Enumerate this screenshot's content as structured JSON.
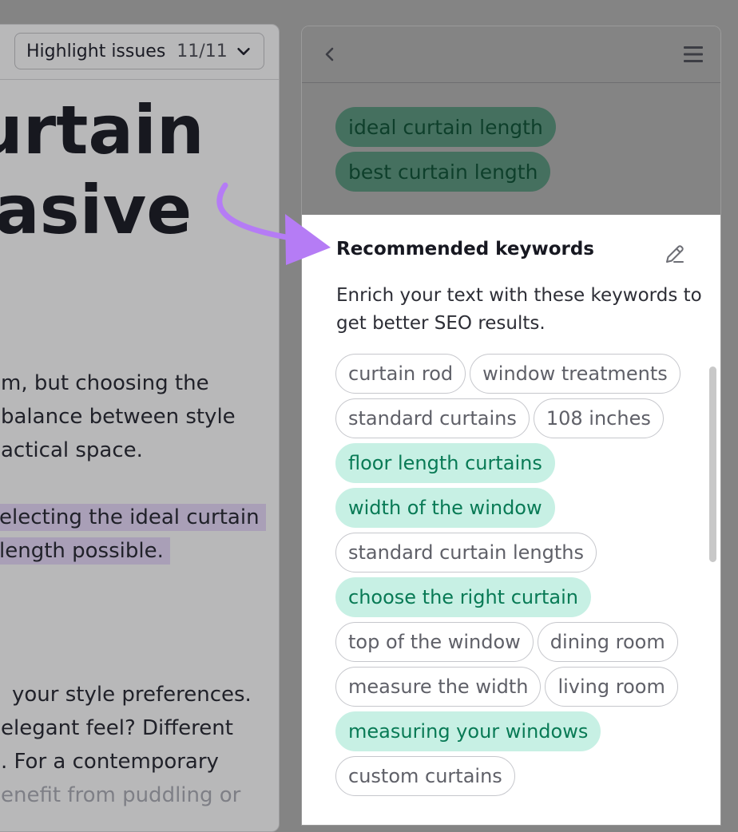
{
  "editor": {
    "highlight_label": "Highlight issues",
    "highlight_count": "11/11",
    "headline": [
      "urtain",
      "asive"
    ],
    "para1": [
      "m, but choosing the",
      "balance between style",
      "actical space."
    ],
    "para2": [
      "electing the ideal curtain",
      "length possible."
    ],
    "para3": [
      "your style preferences.",
      "elegant feel? Different",
      ". For a contemporary",
      "enefit from puddling or"
    ]
  },
  "panel": {
    "back_icon": "chevron-left-icon",
    "menu_icon": "hamburger-menu-icon",
    "used_target_keywords": [
      "ideal curtain length",
      "best curtain length"
    ],
    "recommended": {
      "title": "Recommended keywords",
      "edit_icon": "pencil-icon",
      "description": "Enrich your text with these keywords to get better SEO results.",
      "keywords": [
        {
          "label": "curtain rod",
          "used": false
        },
        {
          "label": "window treatments",
          "used": false
        },
        {
          "label": "standard curtains",
          "used": false
        },
        {
          "label": "108 inches",
          "used": false
        },
        {
          "label": "floor length curtains",
          "used": true
        },
        {
          "label": "width of the window",
          "used": true
        },
        {
          "label": "standard curtain lengths",
          "used": false
        },
        {
          "label": "choose the right curtain",
          "used": true
        },
        {
          "label": "top of the window",
          "used": false
        },
        {
          "label": "dining room",
          "used": false
        },
        {
          "label": "measure the width",
          "used": false
        },
        {
          "label": "living room",
          "used": false
        },
        {
          "label": "measuring your windows",
          "used": true
        },
        {
          "label": "custom curtains",
          "used": false
        }
      ]
    }
  },
  "colors": {
    "accent_arrow": "#b57cf5",
    "used_chip_bg": "#c7f0e4",
    "used_chip_text": "#087a55"
  }
}
